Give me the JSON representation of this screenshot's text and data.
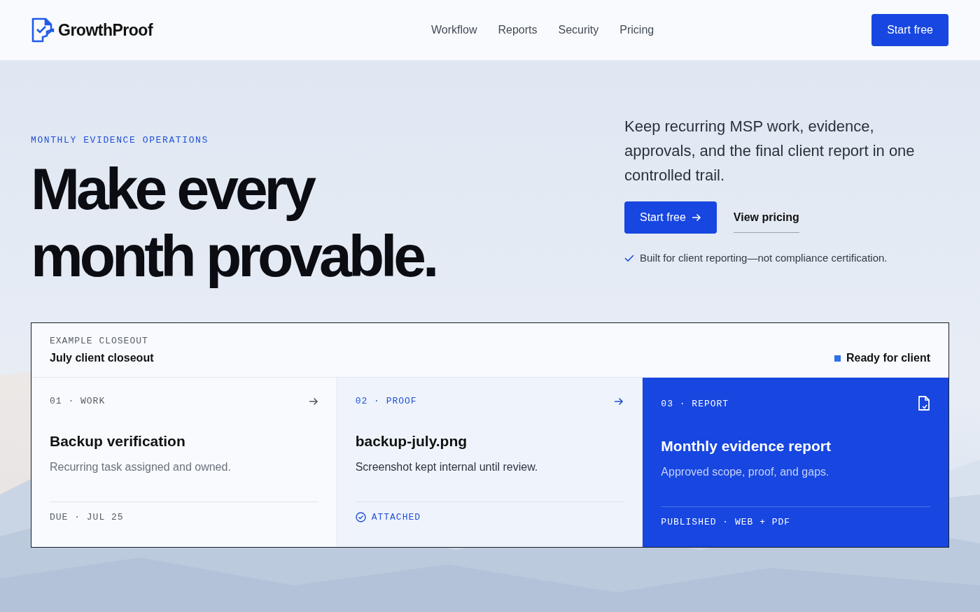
{
  "header": {
    "brand": "GrowthProof",
    "nav": [
      {
        "label": "Workflow"
      },
      {
        "label": "Reports"
      },
      {
        "label": "Security"
      },
      {
        "label": "Pricing"
      }
    ],
    "cta": "Start free"
  },
  "hero": {
    "eyebrow": "MONTHLY EVIDENCE OPERATIONS",
    "title_lines": [
      "Make every",
      "month provable."
    ],
    "lede": "Keep recurring MSP work, evidence, approvals, and the final client report in one controlled trail.",
    "primary": "Start free",
    "secondary": "View pricing",
    "note": "Built for client reporting—not compliance certification."
  },
  "closeout": {
    "eyebrow": "EXAMPLE CLOSEOUT",
    "title": "July client closeout",
    "status": {
      "label": "Ready for client",
      "color": "#2f6fe8"
    },
    "steps": [
      {
        "kind": "work",
        "label": "01 · WORK",
        "title": "Backup verification",
        "desc": "Recurring task assigned and owned.",
        "footer": "DUE · JUL 25"
      },
      {
        "kind": "proof",
        "label": "02 · PROOF",
        "title": "backup-july.png",
        "desc": "Screenshot kept internal until review.",
        "footer": "ATTACHED"
      },
      {
        "kind": "report",
        "label": "03 · REPORT",
        "title": "Monthly evidence report",
        "desc": "Approved scope, proof, and gaps.",
        "footer": "PUBLISHED · WEB + PDF"
      }
    ]
  }
}
